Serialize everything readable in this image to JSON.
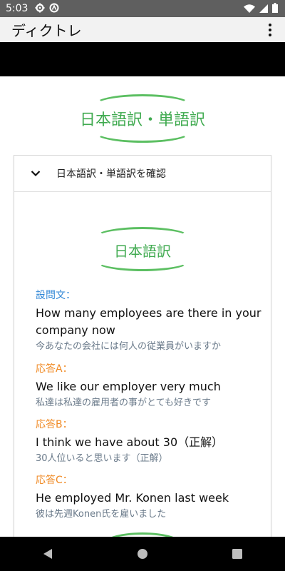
{
  "status_bar": {
    "time": "5:03",
    "icons": [
      "gear-icon",
      "circle-a-icon",
      "wifi-icon",
      "signal-icon",
      "battery-icon"
    ]
  },
  "app_bar": {
    "title": "ディクトレ",
    "menu_icon": "more-vert-icon"
  },
  "page": {
    "main_title": "日本語訳・単語訳"
  },
  "card": {
    "header_label": "日本語訳・単語訳を確認",
    "section_title": "日本語訳",
    "question": {
      "label": "設問文：",
      "english": "How many employees are there in your company now",
      "japanese": "今あなたの会社には何人の従業員がいますか"
    },
    "answers": [
      {
        "label": "応答A：",
        "english": "We like our employer very much",
        "japanese": "私達は私達の雇用者の事がとても好きです"
      },
      {
        "label": "応答B：",
        "english": "I think we have about 30（正解）",
        "japanese": "30人位いると思います（正解）"
      },
      {
        "label": "応答C：",
        "english": "He employed Mr. Konen last week",
        "japanese": "彼は先週Konen氏を雇いました"
      }
    ]
  },
  "colors": {
    "accent_green": "#5cbf62",
    "question_label": "#2f86d6",
    "answer_label": "#f08a24"
  },
  "nav_bar": {
    "icons": [
      "back-icon",
      "home-icon",
      "recents-icon"
    ]
  }
}
